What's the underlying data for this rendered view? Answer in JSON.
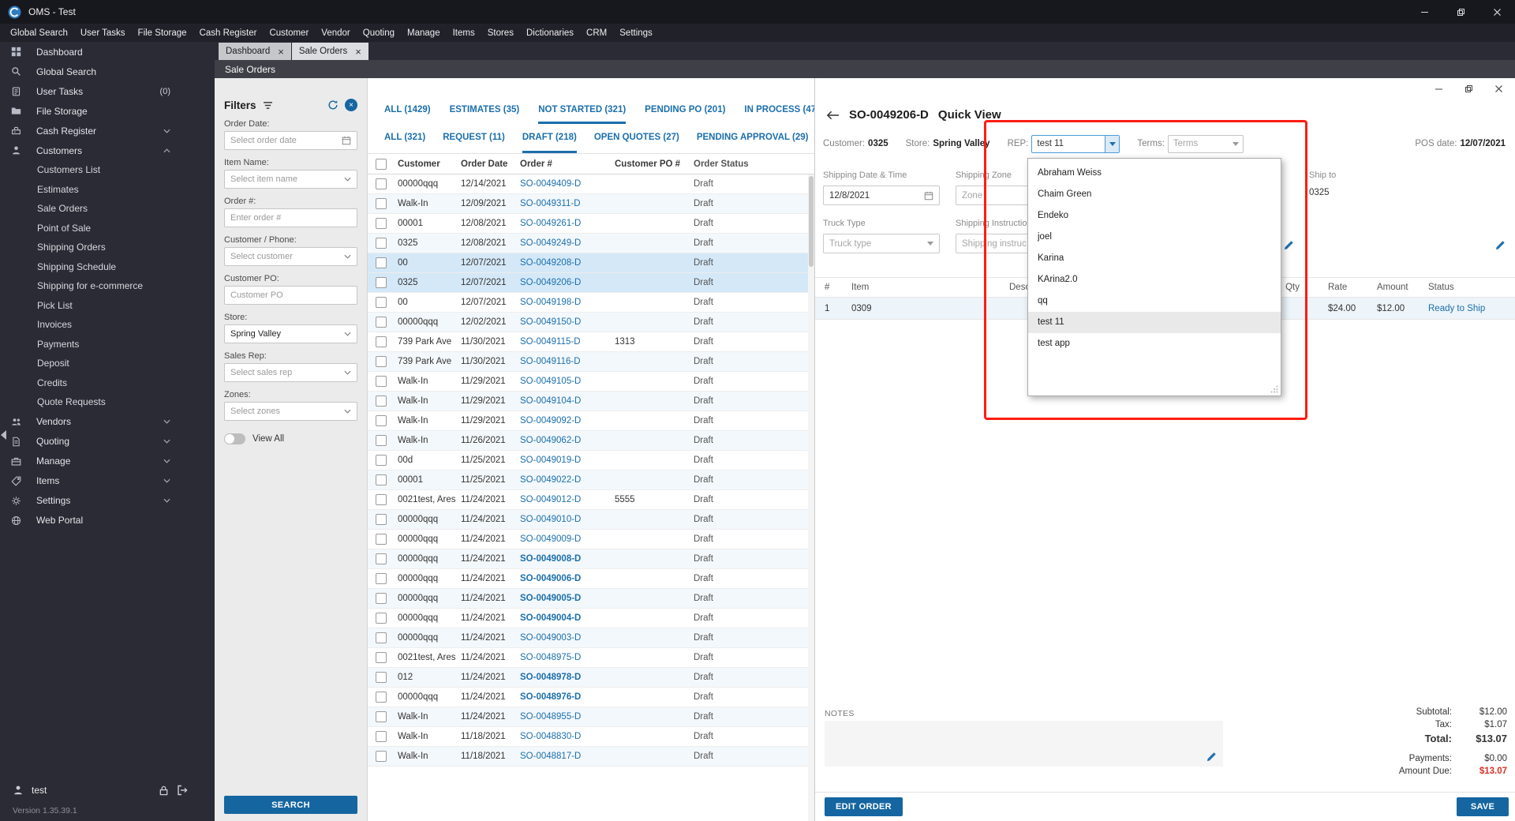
{
  "titlebar": {
    "title": "OMS - Test"
  },
  "menubar": {
    "items": [
      "Global Search",
      "User Tasks",
      "File Storage",
      "Cash Register",
      "Customer",
      "Vendor",
      "Quoting",
      "Manage",
      "Items",
      "Stores",
      "Dictionaries",
      "CRM",
      "Settings"
    ]
  },
  "sidebar": {
    "items": [
      {
        "label": "Dashboard",
        "icon": "dashboard"
      },
      {
        "label": "Global Search",
        "icon": "search"
      },
      {
        "label": "User Tasks",
        "icon": "user-tasks",
        "badge": "(0)"
      },
      {
        "label": "File Storage",
        "icon": "file-storage"
      },
      {
        "label": "Cash Register",
        "icon": "cash-register",
        "chevron": "down"
      },
      {
        "label": "Customers",
        "icon": "customers",
        "chevron": "up",
        "children": [
          "Customers List",
          "Estimates",
          "Sale Orders",
          "Point of Sale",
          "Shipping Orders",
          "Shipping Schedule",
          "Shipping for e-commerce",
          "Pick List",
          "Invoices",
          "Payments",
          "Deposit",
          "Credits",
          "Quote Requests"
        ]
      },
      {
        "label": "Vendors",
        "icon": "vendors",
        "chevron": "down"
      },
      {
        "label": "Quoting",
        "icon": "quoting",
        "chevron": "down"
      },
      {
        "label": "Manage",
        "icon": "manage",
        "chevron": "down"
      },
      {
        "label": "Items",
        "icon": "items",
        "chevron": "down"
      },
      {
        "label": "Settings",
        "icon": "settings",
        "chevron": "down"
      },
      {
        "label": "Web Portal",
        "icon": "web-portal"
      }
    ],
    "user": "test",
    "version": "Version 1.35.39.1"
  },
  "tabstrip": {
    "tabs": [
      {
        "label": "Dashboard",
        "active": false
      },
      {
        "label": "Sale Orders",
        "active": true
      }
    ]
  },
  "panel": {
    "title": "Sale Orders"
  },
  "filters": {
    "title": "Filters",
    "fields": [
      {
        "label": "Order Date:",
        "placeholder": "Select order date",
        "type": "date"
      },
      {
        "label": "Item Name:",
        "placeholder": "Select item name",
        "type": "select"
      },
      {
        "label": "Order #:",
        "placeholder": "Enter order #",
        "type": "text"
      },
      {
        "label": "Customer / Phone:",
        "placeholder": "Select customer",
        "type": "select"
      },
      {
        "label": "Customer PO:",
        "placeholder": "Customer PO",
        "type": "text"
      },
      {
        "label": "Store:",
        "value": "Spring Valley",
        "type": "select"
      },
      {
        "label": "Sales Rep:",
        "placeholder": "Select sales rep",
        "type": "select"
      },
      {
        "label": "Zones:",
        "placeholder": "Select zones",
        "type": "select"
      }
    ],
    "toggle_label": "View All",
    "search_label": "SEARCH"
  },
  "status_tabs": {
    "row1": [
      {
        "label": "ALL (1429)",
        "active": false
      },
      {
        "label": "ESTIMATES (35)",
        "active": false
      },
      {
        "label": "NOT STARTED (321)",
        "active": true
      },
      {
        "label": "PENDING PO (201)",
        "active": false
      },
      {
        "label": "IN PROCESS (47",
        "active": false
      }
    ],
    "row2": [
      {
        "label": "ALL (321)",
        "active": false
      },
      {
        "label": "REQUEST (11)",
        "active": false
      },
      {
        "label": "DRAFT (218)",
        "active": true
      },
      {
        "label": "OPEN QUOTES (27)",
        "active": false
      },
      {
        "label": "PENDING APPROVAL (29)",
        "active": false
      }
    ]
  },
  "orders": {
    "columns": [
      "Customer",
      "Order Date",
      "Order #",
      "Customer PO #",
      "Order Status"
    ],
    "rows": [
      {
        "customer": "00000qqq",
        "date": "12/14/2021",
        "order": "SO-0049409-D",
        "po": "",
        "status": "Draft"
      },
      {
        "customer": "Walk-In",
        "date": "12/09/2021",
        "order": "SO-0049311-D",
        "po": "",
        "status": "Draft"
      },
      {
        "customer": "00001",
        "date": "12/08/2021",
        "order": "SO-0049261-D",
        "po": "",
        "status": "Draft"
      },
      {
        "customer": "0325",
        "date": "12/08/2021",
        "order": "SO-0049249-D",
        "po": "",
        "status": "Draft"
      },
      {
        "customer": "00",
        "date": "12/07/2021",
        "order": "SO-0049208-D",
        "po": "",
        "status": "Draft",
        "selected": true
      },
      {
        "customer": "0325",
        "date": "12/07/2021",
        "order": "SO-0049206-D",
        "po": "",
        "status": "Draft",
        "selected": true
      },
      {
        "customer": "00",
        "date": "12/07/2021",
        "order": "SO-0049198-D",
        "po": "",
        "status": "Draft"
      },
      {
        "customer": "00000qqq",
        "date": "12/02/2021",
        "order": "SO-0049150-D",
        "po": "",
        "status": "Draft"
      },
      {
        "customer": "739 Park Ave",
        "date": "11/30/2021",
        "order": "SO-0049115-D",
        "po": "1313",
        "status": "Draft"
      },
      {
        "customer": "739 Park Ave",
        "date": "11/30/2021",
        "order": "SO-0049116-D",
        "po": "",
        "status": "Draft"
      },
      {
        "customer": "Walk-In",
        "date": "11/29/2021",
        "order": "SO-0049105-D",
        "po": "",
        "status": "Draft"
      },
      {
        "customer": "Walk-In",
        "date": "11/29/2021",
        "order": "SO-0049104-D",
        "po": "",
        "status": "Draft"
      },
      {
        "customer": "Walk-In",
        "date": "11/29/2021",
        "order": "SO-0049092-D",
        "po": "",
        "status": "Draft"
      },
      {
        "customer": "Walk-In",
        "date": "11/26/2021",
        "order": "SO-0049062-D",
        "po": "",
        "status": "Draft"
      },
      {
        "customer": "00d",
        "date": "11/25/2021",
        "order": "SO-0049019-D",
        "po": "",
        "status": "Draft"
      },
      {
        "customer": "00001",
        "date": "11/25/2021",
        "order": "SO-0049022-D",
        "po": "",
        "status": "Draft"
      },
      {
        "customer": "0021test, Ares",
        "date": "11/24/2021",
        "order": "SO-0049012-D",
        "po": "5555",
        "status": "Draft"
      },
      {
        "customer": "00000qqq",
        "date": "11/24/2021",
        "order": "SO-0049010-D",
        "po": "",
        "status": "Draft"
      },
      {
        "customer": "00000qqq",
        "date": "11/24/2021",
        "order": "SO-0049009-D",
        "po": "",
        "status": "Draft"
      },
      {
        "customer": "00000qqq",
        "date": "11/24/2021",
        "order": "SO-0049008-D",
        "po": "",
        "status": "Draft",
        "bold": true
      },
      {
        "customer": "00000qqq",
        "date": "11/24/2021",
        "order": "SO-0049006-D",
        "po": "",
        "status": "Draft",
        "bold": true
      },
      {
        "customer": "00000qqq",
        "date": "11/24/2021",
        "order": "SO-0049005-D",
        "po": "",
        "status": "Draft",
        "bold": true
      },
      {
        "customer": "00000qqq",
        "date": "11/24/2021",
        "order": "SO-0049004-D",
        "po": "",
        "status": "Draft",
        "bold": true
      },
      {
        "customer": "00000qqq",
        "date": "11/24/2021",
        "order": "SO-0049003-D",
        "po": "",
        "status": "Draft"
      },
      {
        "customer": "0021test, Ares",
        "date": "11/24/2021",
        "order": "SO-0048975-D",
        "po": "",
        "status": "Draft"
      },
      {
        "customer": "012",
        "date": "11/24/2021",
        "order": "SO-0048978-D",
        "po": "",
        "status": "Draft",
        "bold": true
      },
      {
        "customer": "00000qqq",
        "date": "11/24/2021",
        "order": "SO-0048976-D",
        "po": "",
        "status": "Draft",
        "bold": true
      },
      {
        "customer": "Walk-In",
        "date": "11/24/2021",
        "order": "SO-0048955-D",
        "po": "",
        "status": "Draft"
      },
      {
        "customer": "Walk-In",
        "date": "11/18/2021",
        "order": "SO-0048830-D",
        "po": "",
        "status": "Draft"
      },
      {
        "customer": "Walk-In",
        "date": "11/18/2021",
        "order": "SO-0048817-D",
        "po": "",
        "status": "Draft"
      }
    ]
  },
  "quickview": {
    "title": "SO-0049206-D",
    "subtitle": "Quick View",
    "header_fields": {
      "customer_label": "Customer:",
      "customer": "0325",
      "store_label": "Store:",
      "store": "Spring Valley",
      "rep_label": "REP:",
      "rep": "test 11",
      "terms_label": "Terms:",
      "terms": "Terms",
      "pos_date_label": "POS date:",
      "pos_date": "12/07/2021"
    },
    "shipping": {
      "date_label": "Shipping Date & Time",
      "date": "12/8/2021",
      "zone_label": "Shipping Zone",
      "zone_placeholder": "Zone",
      "ship_to_label": "Ship to",
      "ship_to": "0325",
      "truck_label": "Truck Type",
      "truck_placeholder": "Truck type",
      "instructions_label": "Shipping Instructions",
      "instructions_placeholder": "Shipping instruc"
    },
    "items": {
      "columns": [
        "#",
        "Item",
        "Description",
        "Qty",
        "Rate",
        "Amount",
        "Status"
      ],
      "rows": [
        {
          "num": "1",
          "item": "0309",
          "description": "",
          "qty": "",
          "rate": "$24.00",
          "amount": "$12.00",
          "status": "Ready to Ship"
        }
      ]
    },
    "notes_label": "NOTES",
    "totals": [
      {
        "label": "Subtotal:",
        "value": "$12.00"
      },
      {
        "label": "Tax:",
        "value": "$1.07"
      },
      {
        "label": "Total:",
        "value": "$13.07",
        "bold": true
      },
      {
        "label": "Payments:",
        "value": "$0.00"
      },
      {
        "label": "Amount Due:",
        "value": "$13.07",
        "red": true
      }
    ],
    "edit_button": "EDIT ORDER",
    "save_button": "SAVE"
  },
  "rep_dropdown": {
    "options": [
      "Abraham Weiss",
      "Chaim Green",
      "Endeko",
      "joel",
      "Karina",
      "KArina2.0",
      "qq",
      "test 11",
      "test app"
    ],
    "selected": "test 11"
  },
  "colors": {
    "accent": "#1566a0",
    "link": "#1b6fad",
    "annotation_red": "#fe1c12",
    "amount_due_red": "#d93025",
    "status_ready": "#1b6fad",
    "selected_row": "#d4e8f8"
  }
}
